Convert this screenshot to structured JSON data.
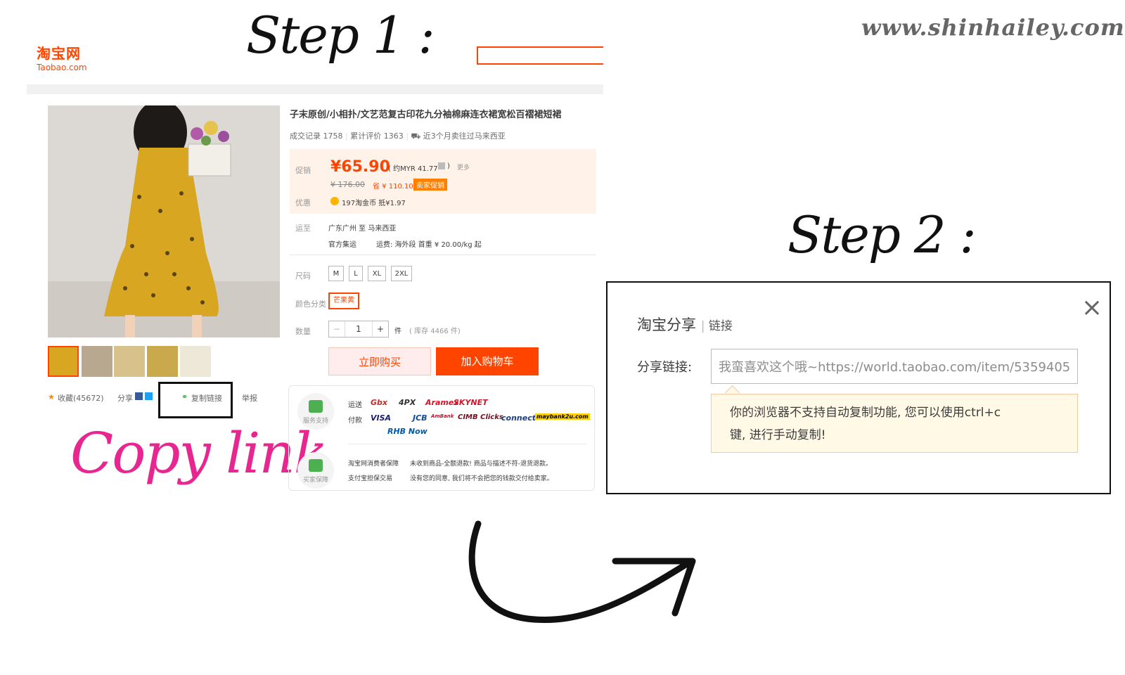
{
  "titles": {
    "step1": "Step 1 :",
    "step2": "Step 2 :",
    "watermark": "www.shinhailey.com",
    "copy_link": "Copy link"
  },
  "taobao": {
    "logo_cn": "淘宝网",
    "logo_en": "Taobao.com"
  },
  "product": {
    "title": "子末原创/小相扑/文艺范复古印花九分袖棉麻连衣裙宽松百褶裙短裙",
    "stats": {
      "deals": "成交记录 1758",
      "reviews": "累计评价 1363",
      "shipping_note": "近3个月卖往过马来西亚"
    },
    "price": {
      "label_promo": "促销",
      "current": "¥65.90",
      "myr": "( 约MYR 41.77",
      "myr_close": ")",
      "more": "更多",
      "original": "¥ 176.00",
      "save": "省 ¥ 110.10",
      "seller_promo": "卖家促销",
      "label_discount": "优惠",
      "coins": "197淘金币 抵¥1.97"
    },
    "shipping": {
      "label": "运至",
      "route": "广东广州 至 马来西亚",
      "method": "官方集运",
      "fee": "运费: 海外段 首重 ¥ 20.00/kg 起"
    },
    "size": {
      "label": "尺码",
      "options": [
        "M",
        "L",
        "XL",
        "2XL"
      ]
    },
    "color": {
      "label": "颜色分类",
      "selected": "芒果黄"
    },
    "quantity": {
      "label": "数量",
      "minus": "−",
      "value": "1",
      "plus": "+",
      "unit": "件",
      "stock": "( 库存 4466 件)"
    },
    "buttons": {
      "buy_now": "立即购买",
      "add_cart": "加入购物车"
    },
    "share_row": {
      "favorites": "收藏(45672)",
      "share": "分享",
      "copy_link": "复制链接",
      "report": "举报"
    },
    "service": {
      "support_label": "服务支持",
      "shipping_label": "运送",
      "payment_label": "付款",
      "shipping_logos": [
        "Gbx",
        "4PX",
        "Aramex",
        "SKYNET"
      ],
      "payment_logos": [
        "VISA",
        "JCB",
        "AmBank",
        "CIMB Clicks",
        "connect",
        "maybank2u.com",
        "RHB Now"
      ],
      "protection_label": "买家保障",
      "protection_line1_title": "淘宝网消费者保障",
      "protection_line1_text": "未收到商品-全额退款! 商品与描述不符-退货退款。",
      "protection_line2_title": "支付宝担保交易",
      "protection_line2_text": "没有您的同意, 我们将不会把您的钱款交付给卖家。"
    }
  },
  "dialog": {
    "title": "淘宝分享",
    "subtitle": "链接",
    "close": "×",
    "link_label": "分享链接:",
    "link_value": "我蛮喜欢这个哦~https://world.taobao.com/item/5359405",
    "tip_line1": "你的浏览器不支持自动复制功能, 您可以使用ctrl+c",
    "tip_line2": "键, 进行手动复制!"
  },
  "colors": {
    "taobao_orange": "#ff4400",
    "copy_link_pink": "#e8268f",
    "dress_yellow": "#d8a621"
  }
}
